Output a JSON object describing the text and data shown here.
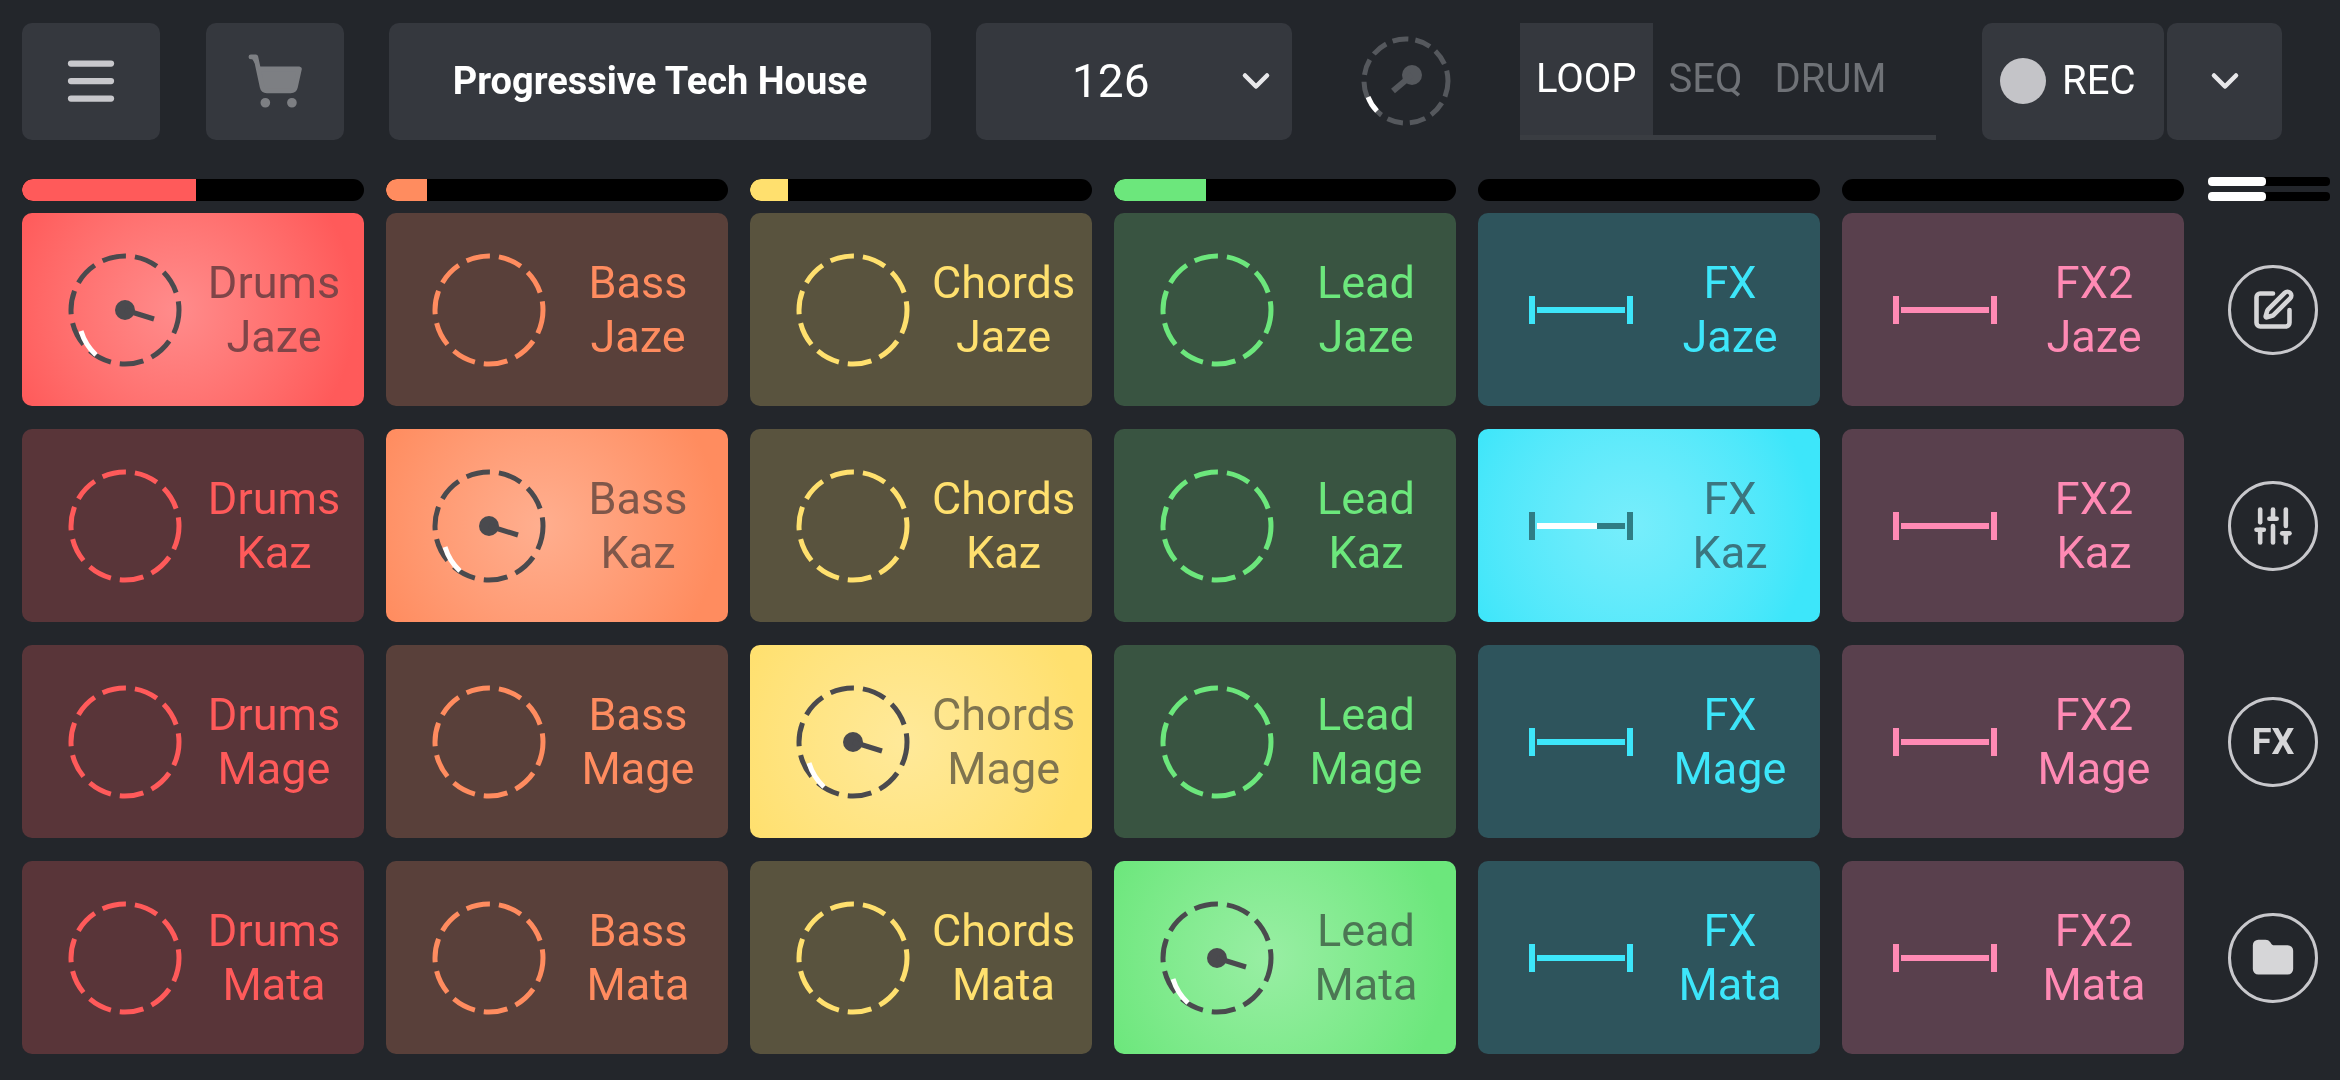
{
  "toolbar": {
    "title": "Progressive Tech House",
    "tempo": "126",
    "modes": [
      {
        "label": "LOOP",
        "selected": true
      },
      {
        "label": "SEQ",
        "selected": false
      },
      {
        "label": "DRUM",
        "selected": false
      }
    ],
    "record": {
      "label": "REC"
    }
  },
  "tracks": [
    {
      "color": "#ff5a5a",
      "kind": "loop",
      "level": 0.51,
      "pads": [
        {
          "title": "Drums",
          "subtitle": "Jaze",
          "playing": true
        },
        {
          "title": "Drums",
          "subtitle": "Kaz",
          "playing": false
        },
        {
          "title": "Drums",
          "subtitle": "Mage",
          "playing": false
        },
        {
          "title": "Drums",
          "subtitle": "Mata",
          "playing": false
        }
      ]
    },
    {
      "color": "#ff8c5f",
      "kind": "loop",
      "level": 0.12,
      "pads": [
        {
          "title": "Bass",
          "subtitle": "Jaze",
          "playing": false
        },
        {
          "title": "Bass",
          "subtitle": "Kaz",
          "playing": true
        },
        {
          "title": "Bass",
          "subtitle": "Mage",
          "playing": false
        },
        {
          "title": "Bass",
          "subtitle": "Mata",
          "playing": false
        }
      ]
    },
    {
      "color": "#ffe06e",
      "kind": "loop",
      "level": 0.11,
      "pads": [
        {
          "title": "Chords",
          "subtitle": "Jaze",
          "playing": false
        },
        {
          "title": "Chords",
          "subtitle": "Kaz",
          "playing": false
        },
        {
          "title": "Chords",
          "subtitle": "Mage",
          "playing": true
        },
        {
          "title": "Chords",
          "subtitle": "Mata",
          "playing": false
        }
      ]
    },
    {
      "color": "#6ce77c",
      "kind": "loop",
      "level": 0.27,
      "pads": [
        {
          "title": "Lead",
          "subtitle": "Jaze",
          "playing": false
        },
        {
          "title": "Lead",
          "subtitle": "Kaz",
          "playing": false
        },
        {
          "title": "Lead",
          "subtitle": "Mage",
          "playing": false
        },
        {
          "title": "Lead",
          "subtitle": "Mata",
          "playing": true
        }
      ]
    },
    {
      "color": "#3de6fa",
      "kind": "oneshot",
      "level": 0,
      "pads": [
        {
          "title": "FX",
          "subtitle": "Jaze",
          "playing": false
        },
        {
          "title": "FX",
          "subtitle": "Kaz",
          "playing": true
        },
        {
          "title": "FX",
          "subtitle": "Mage",
          "playing": false
        },
        {
          "title": "FX",
          "subtitle": "Mata",
          "playing": false
        }
      ]
    },
    {
      "color": "#ff8ab4",
      "kind": "oneshot",
      "level": 0,
      "pads": [
        {
          "title": "FX2",
          "subtitle": "Jaze",
          "playing": false
        },
        {
          "title": "FX2",
          "subtitle": "Kaz",
          "playing": false
        },
        {
          "title": "FX2",
          "subtitle": "Mage",
          "playing": false
        },
        {
          "title": "FX2",
          "subtitle": "Mata",
          "playing": false
        }
      ]
    }
  ],
  "side_tools": [
    {
      "kind": "edit"
    },
    {
      "kind": "mixer"
    },
    {
      "kind": "fx",
      "label": "FX"
    },
    {
      "kind": "folder"
    }
  ]
}
